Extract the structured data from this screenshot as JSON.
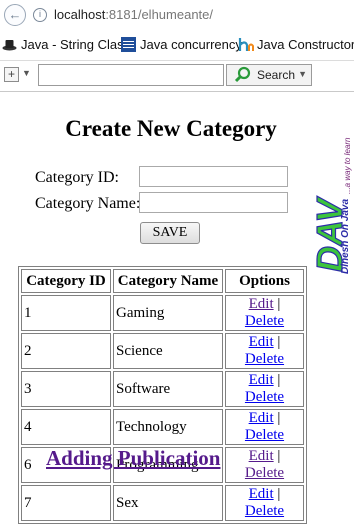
{
  "browser": {
    "url_host": "localhost",
    "url_rest": ":8181/elhumeante/",
    "bookmarks": [
      {
        "label": "Java - String Class",
        "icon": "hat-icon"
      },
      {
        "label": "Java concurrency",
        "icon": "ibm-icon"
      },
      {
        "label": "Java Constructors",
        "icon": "h-logo-icon"
      }
    ],
    "search_button": "Search",
    "search_value": ""
  },
  "page": {
    "title": "Create New Category",
    "form": {
      "id_label": "Category ID:",
      "name_label": "Category Name:",
      "id_value": "",
      "name_value": "",
      "save_label": "SAVE"
    },
    "table": {
      "headers": [
        "Category ID",
        "Category Name",
        "Options"
      ],
      "rows": [
        {
          "id": "1",
          "name": "Gaming",
          "edit": "Edit",
          "sep": "|",
          "delete": "Delete"
        },
        {
          "id": "2",
          "name": "Science",
          "edit": "Edit",
          "sep": "|",
          "delete": "Delete"
        },
        {
          "id": "3",
          "name": "Software",
          "edit": "Edit",
          "sep": "|",
          "delete": "Delete"
        },
        {
          "id": "4",
          "name": "Technology",
          "edit": "Edit",
          "sep": "|",
          "delete": "Delete"
        },
        {
          "id": "6",
          "name": "Programming",
          "edit": "Edit",
          "sep": "|",
          "delete": "Delete"
        },
        {
          "id": "7",
          "name": "Sex",
          "edit": "Edit",
          "sep": "|",
          "delete": "Delete"
        }
      ]
    },
    "publication_link": "Adding Publication",
    "logo": {
      "brand": "DAV",
      "tagline": "Dinesh On Java",
      "slogan": "...a way to learn",
      "colors": {
        "green": "#3cc43c",
        "blue": "#2c2ca8",
        "purple": "#7a2a7a"
      }
    }
  }
}
